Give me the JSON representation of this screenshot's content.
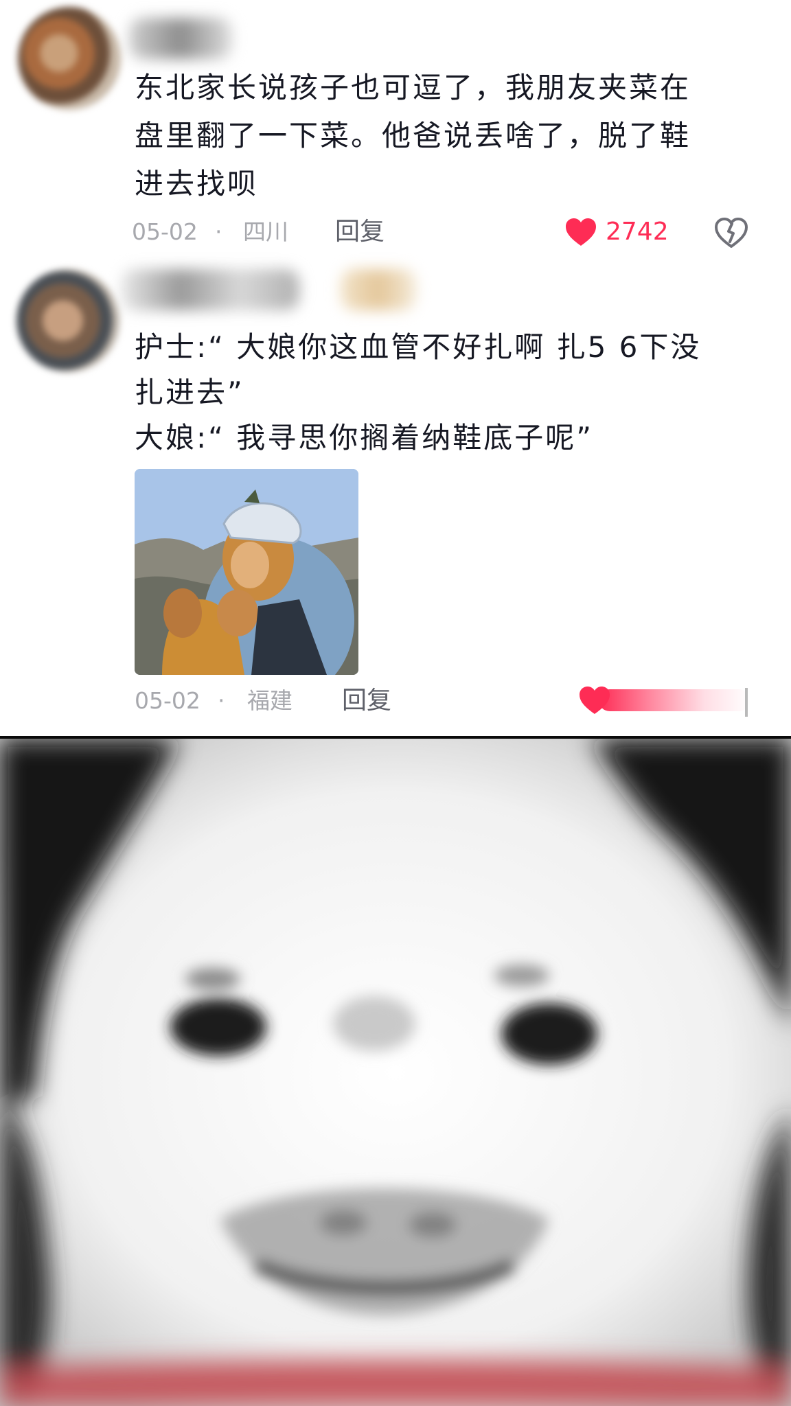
{
  "comments": [
    {
      "lines": [
        "东北家长说孩子也可逗了，我朋友夹菜在",
        "盘里翻了一下菜。他爸说丢啥了，脱了鞋",
        "进去找呗"
      ],
      "date": "05-02",
      "separator": "·",
      "location": "四川",
      "reply_label": "回复",
      "likes": "2742",
      "icons": [
        "avatar",
        "heart-icon",
        "dislike-icon"
      ]
    },
    {
      "lines": [
        "护士:“ 大娘你这血管不好扎啊 扎5 6下没",
        "扎进去”",
        "大娘:“ 我寻思你搁着纳鞋底子呢”"
      ],
      "date": "05-02",
      "separator": "·",
      "location": "福建",
      "reply_label": "回复",
      "icons": [
        "avatar",
        "heart-icon"
      ]
    }
  ],
  "colors": {
    "text": "#161823",
    "meta": "#a7a8ad",
    "like": "#fe2c55",
    "reply": "#5e6069"
  }
}
